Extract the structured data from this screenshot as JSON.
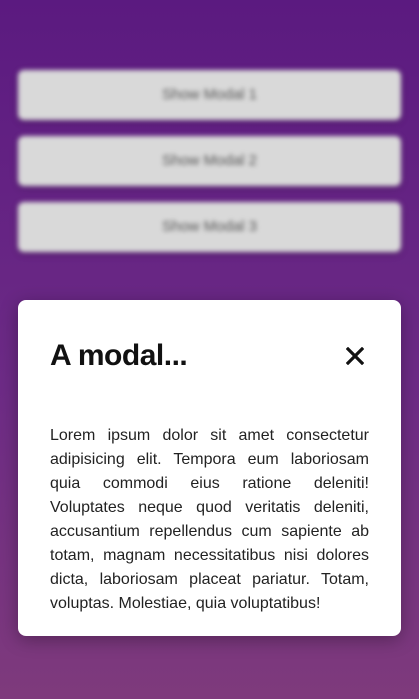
{
  "background_buttons": [
    {
      "label": "Show Modal 1"
    },
    {
      "label": "Show Modal 2"
    },
    {
      "label": "Show Modal 3"
    }
  ],
  "modal": {
    "title": "A modal...",
    "close_icon": "close-icon",
    "body": "Lorem ipsum dolor sit amet consectetur adipisicing elit. Tempora eum laboriosam quia commodi eius ratione deleniti! Voluptates neque quod veritatis deleniti, accusantium repellendus cum sapiente ab totam, magnam necessitatibus nisi dolores dicta, laboriosam placeat pariatur. Totam, voluptas. Molestiae, quia voluptatibus!"
  },
  "colors": {
    "background_top": "#5b1a80",
    "background_bottom": "#7e3a7c",
    "button_bg": "#d9d9d9",
    "modal_bg": "#ffffff"
  }
}
